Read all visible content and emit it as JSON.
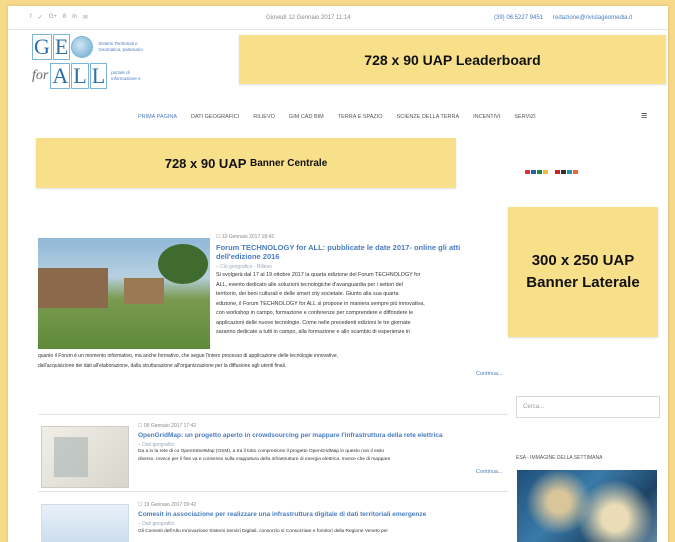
{
  "topbar": {
    "social_icons": [
      "f",
      "✓",
      "G+",
      "8",
      "in",
      "✉"
    ],
    "date": "Giovedì 12 Gennaio 2017 11:14",
    "phone": "(39) 06.5227 9451",
    "email": "redazione@rivistageomedia.it"
  },
  "logo": {
    "geo": [
      "G",
      "E",
      "O"
    ],
    "for": "for",
    "all": [
      "A",
      "L",
      "L"
    ],
    "tagline1": "Sistemi Territoriali e",
    "tagline2": "Geomatica, partenario",
    "tagline3": "portale di",
    "tagline4": "informazione e"
  },
  "ads": {
    "leaderboard": "728 x 90 UAP Leaderboard",
    "center_main": "728 x 90 UAP",
    "center_small": "Banner Centrale",
    "side_line1": "300 x 250 UAP",
    "side_line2": "Banner Laterale"
  },
  "nav": {
    "items": [
      "Prima pagina",
      "Dati geografici",
      "Rilievo",
      "GIM CAD BIM",
      "Terra e spazio",
      "Scienze della terra",
      "Incentivi",
      "Servizi"
    ],
    "menu_icon": "≡"
  },
  "flags": [
    "#d33",
    "#2b5fb0",
    "#1a8a3a",
    "#e7c53a",
    "#fff",
    "#c22",
    "#333",
    "#29a",
    "#e63"
  ],
  "article1": {
    "date": "☐ 10 Gennaio 2017 18:42",
    "title": "Forum TECHNOLOGY for ALL: pubblicate le date 2017- online gli atti dell'edizione 2016",
    "sub": "– Ciò geografico · Rilievo",
    "body": [
      "Si svolgerà dal 17 al 19 ottobre 2017 la quarta edizione del Forum TECHNOLOGY for",
      "ALL, evento dedicato alle soluzioni tecnologiche d'avanguardia per i settori del",
      "territorio, dei beni culturali e delle smart city societate. Giunto alla sua quarta",
      "edizione, il Forum TECHNOLOGY for ALL si propone in maniera sempre più innovativa,",
      "con workshop in campo, formazione e conferenze per comprendere e diffondere le",
      "applicazioni delle nuove tecnologie. Come nelle precedenti edizioni le tre giornate",
      "saranno dedicate a tutti in campo, alla formazione e allo scambio di esperienze in"
    ],
    "body_wide": [
      "quanto il Forum è un momento informativo, ma anche formativo, che segue l'intero processo di applicazione delle tecnologie innovative,",
      "dall'acquisizione dei dati all'elaborazione, dalla strutturazione all'organizzazione per la diffusione agli utenti finali."
    ],
    "more": "Continua..."
  },
  "article2": {
    "date": "☐ 09 Gennaio 2017 17:42",
    "title": "OpenGridMap: un progetto aperto in crowdsourcing per mappare l'infrastruttura della rete elettrica",
    "sub": "– Dati geografici",
    "body": [
      "Da a in la rete di co OpenStreetMap (OSM), a tra il tutto compresione il progetto OpenGridMap in questo non il esito",
      "diverso. Invece per il fine va e consenso sulla mappatura della infrastrutture di energia elettrica. Invece che di mappare"
    ],
    "more": "Continua..."
  },
  "article3": {
    "date": "☐ 19 Gennaio 2017 09:42",
    "title": "Comesit in associazione per realizzare una infrastruttura digitale di dati territoriali emergenze",
    "sub": "– Dati geografici",
    "body": [
      "Gli Comesit dell'Alto Innovazione Sistemi Servizi Digitali, consorzio si Consorziate e fornitori della Regione Veneto per"
    ]
  },
  "sidebar": {
    "search_placeholder": "Cerca...",
    "esa_title": "ESA - IMMAGINE DELLA SETTIMANA"
  }
}
